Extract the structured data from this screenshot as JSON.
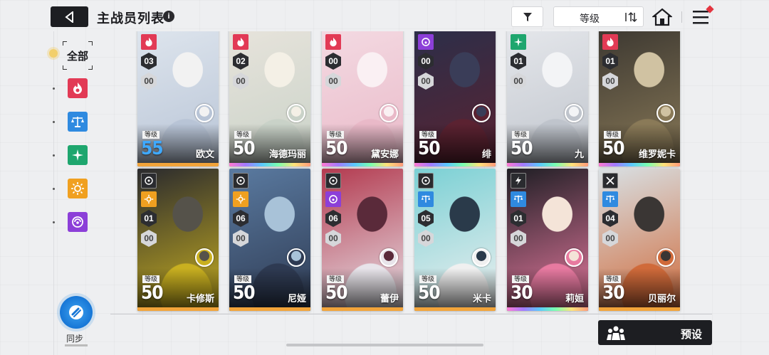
{
  "header": {
    "title": "主战员列表",
    "info_glyph": "i",
    "sort_label": "等级"
  },
  "sidebar": {
    "all_label": "全部",
    "filters": [
      {
        "name": "burn",
        "color": "#e23a55"
      },
      {
        "name": "order",
        "color": "#2f8ae0"
      },
      {
        "name": "spectre",
        "color": "#1ea66e"
      },
      {
        "name": "heat",
        "color": "#f0a020"
      },
      {
        "name": "chaos",
        "color": "#8c3fd8"
      }
    ],
    "sync_label": "同步"
  },
  "cards": [
    {
      "name": "欧文",
      "level": "55",
      "num1": "03",
      "num2": "00",
      "element": "burn",
      "rarity": "orange",
      "level_style": "blue",
      "top_partial": true
    },
    {
      "name": "海德玛丽",
      "level": "50",
      "num1": "02",
      "num2": "00",
      "element": "burn",
      "rarity": "rainbow",
      "top_partial": true
    },
    {
      "name": "黛安娜",
      "level": "50",
      "num1": "00",
      "num2": "00",
      "element": "burn",
      "rarity": "rainbow",
      "top_partial": true
    },
    {
      "name": "绯",
      "level": "50",
      "num1": "00",
      "num2": "00",
      "element": "chaos",
      "rarity": "rainbow",
      "top_partial": true
    },
    {
      "name": "九",
      "level": "50",
      "num1": "01",
      "num2": "00",
      "element": "spectre",
      "rarity": "rainbow",
      "top_partial": true
    },
    {
      "name": "维罗妮卡",
      "level": "50",
      "num1": "01",
      "num2": "00",
      "element": "burn",
      "rarity": "rainbow",
      "top_partial": true
    },
    {
      "name": "卡修斯",
      "level": "50",
      "num1": "01",
      "num2": "00",
      "element": "heat",
      "rarity": "orange"
    },
    {
      "name": "尼娅",
      "level": "50",
      "num1": "06",
      "num2": "00",
      "element": "heat",
      "rarity": "orange"
    },
    {
      "name": "蕾伊",
      "level": "50",
      "num1": "06",
      "num2": "00",
      "element": "chaos",
      "rarity": "orange"
    },
    {
      "name": "米卡",
      "level": "50",
      "num1": "05",
      "num2": "00",
      "element": "order",
      "rarity": "orange"
    },
    {
      "name": "莉姮",
      "level": "30",
      "num1": "01",
      "num2": "00",
      "element": "order",
      "rarity": "rainbow"
    },
    {
      "name": "贝丽尔",
      "level": "30",
      "num1": "04",
      "num2": "00",
      "element": "order",
      "rarity": "orange"
    }
  ],
  "level_tag": "等级",
  "preset_label": "预设"
}
